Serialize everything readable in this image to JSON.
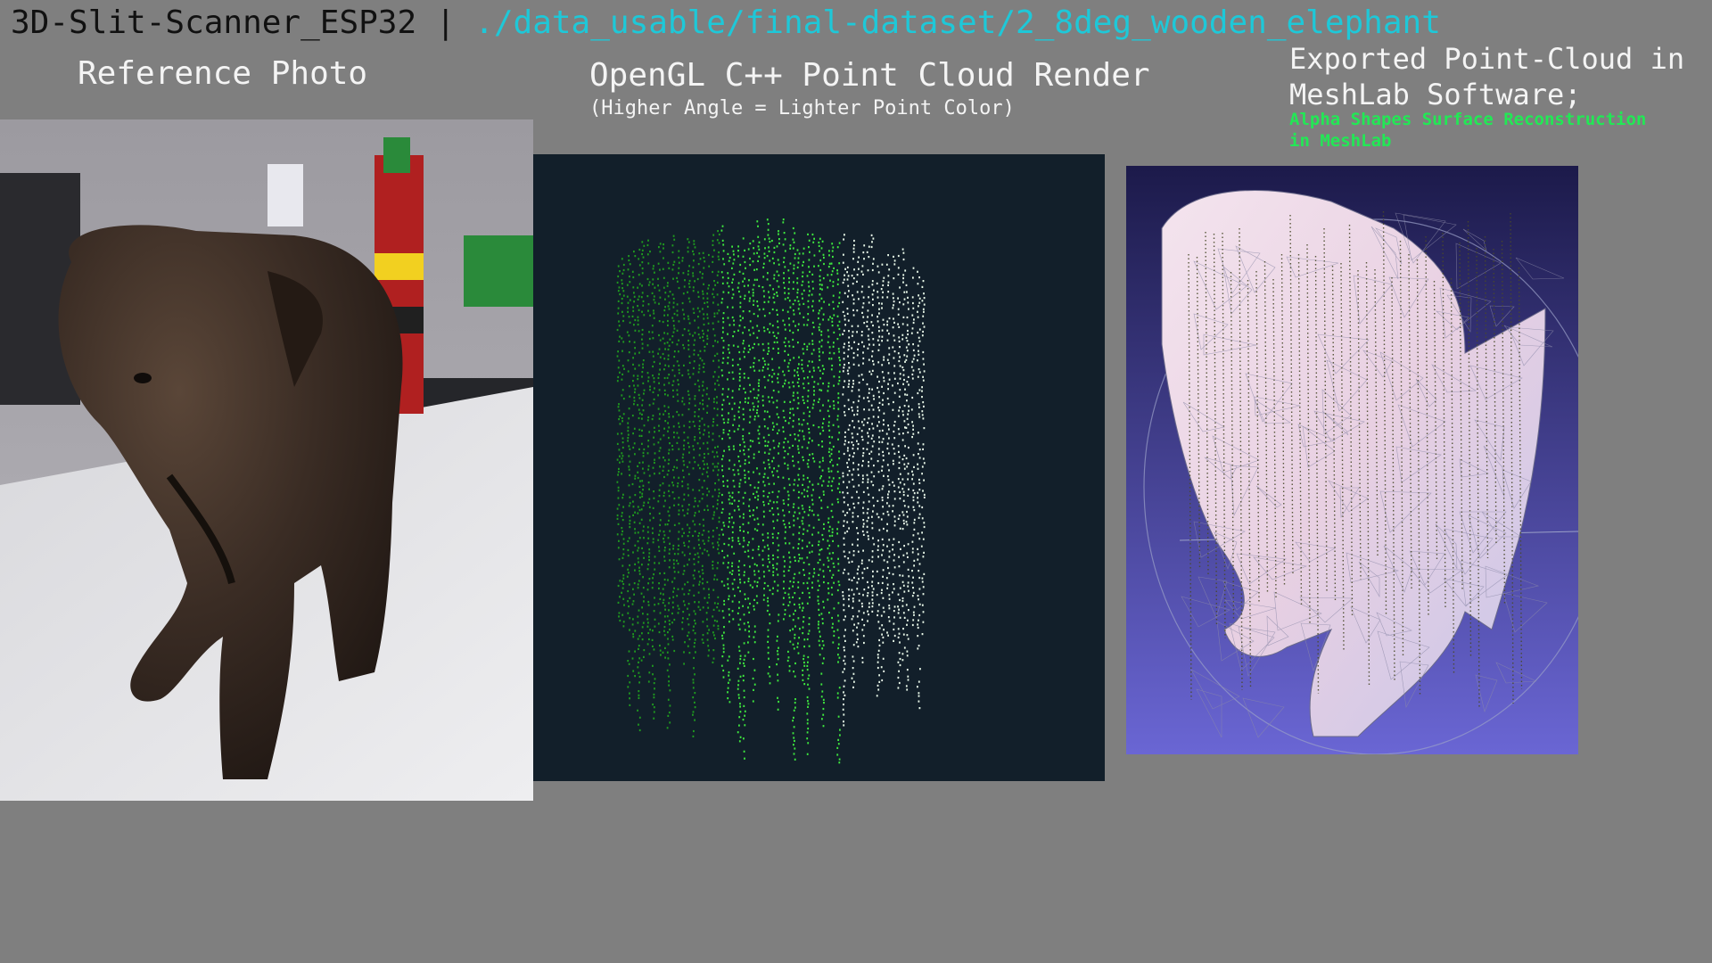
{
  "header": {
    "app_title": "3D-Slit-Scanner_ESP32",
    "separator": " | ",
    "dataset_path": "./data_usable/final-dataset/2_8deg_wooden_elephant"
  },
  "panels": {
    "reference": {
      "title": "Reference Photo"
    },
    "opengl": {
      "title": "OpenGL C++ Point Cloud Render",
      "subtitle": "(Higher Angle = Lighter Point Color)"
    },
    "meshlab": {
      "title": "Exported Point-Cloud in\nMeshLab Software;",
      "subtitle": "Alpha Shapes Surface Reconstruction\nin MeshLab"
    }
  },
  "colors": {
    "background": "#7f7f7f",
    "path_accent": "#1ec8d8",
    "render_bg": "#121f2a",
    "point_dark_green": "#1f9a1f",
    "point_bright_green": "#3ee83e",
    "point_light": "#e8f8e8",
    "meshlab_bg_top": "#1c1a4a",
    "meshlab_bg_bottom": "#6a66d4",
    "mesh_fill": "#f0d6e6",
    "subtitle_green": "#22e855"
  }
}
